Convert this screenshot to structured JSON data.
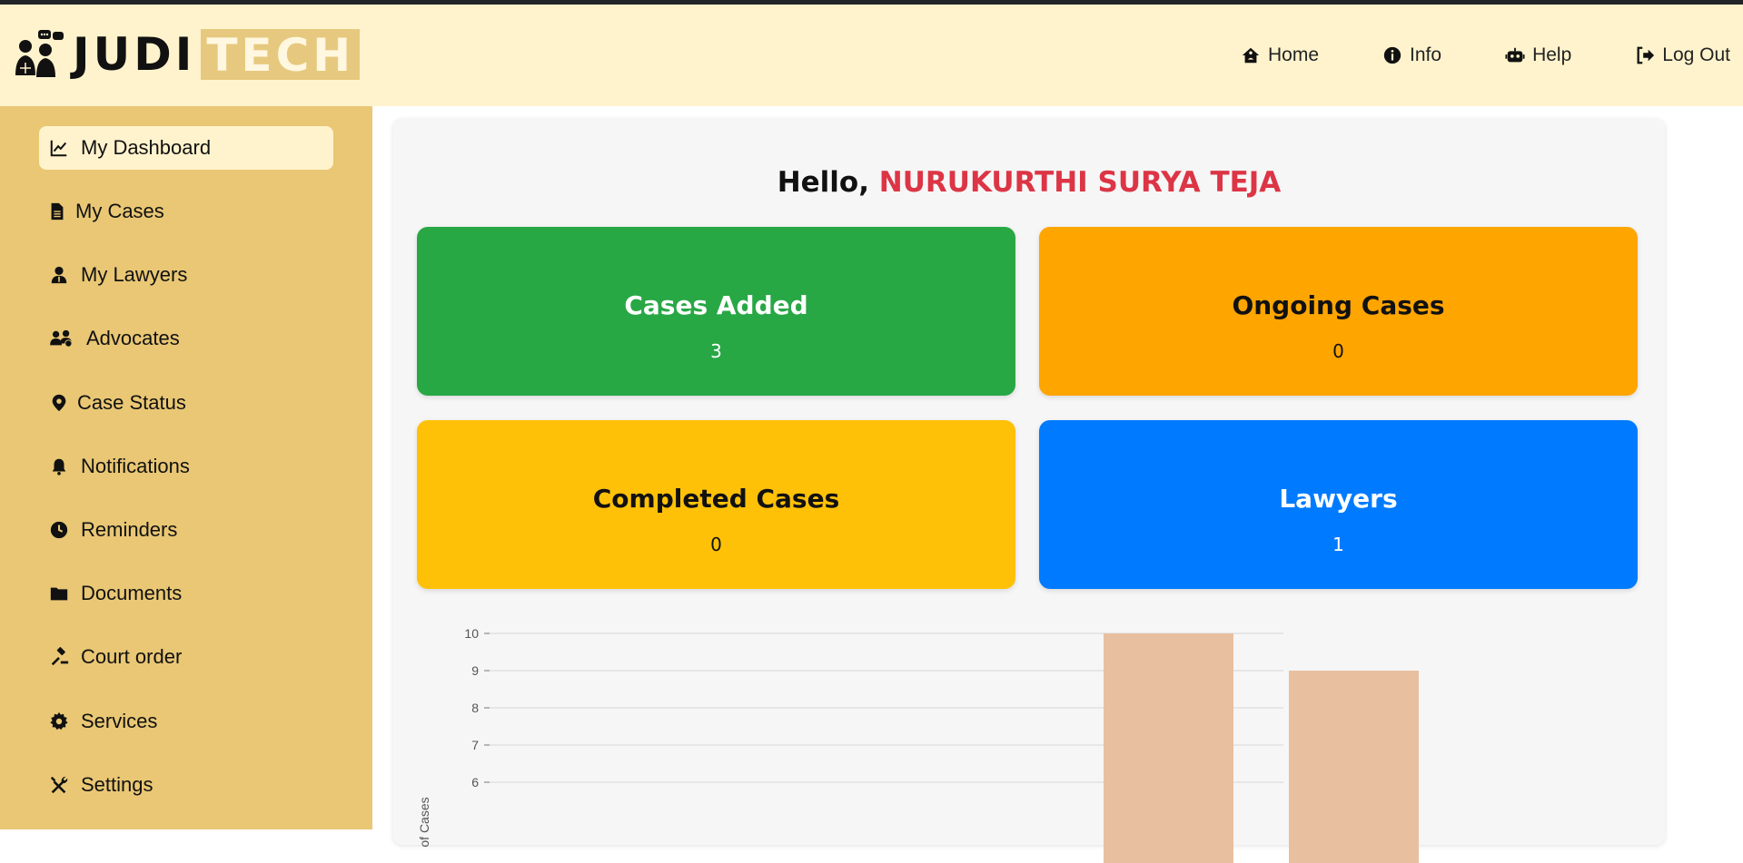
{
  "header": {
    "logo_part1": "JUDI",
    "logo_part2": "TECH",
    "nav": [
      {
        "label": "Home",
        "icon": "home-icon"
      },
      {
        "label": "Info",
        "icon": "info-icon"
      },
      {
        "label": "Help",
        "icon": "robot-icon"
      },
      {
        "label": "Log Out",
        "icon": "logout-icon"
      }
    ]
  },
  "sidebar": {
    "items": [
      {
        "label": "My Dashboard",
        "icon": "chart-line-icon",
        "active": true
      },
      {
        "label": "My Cases",
        "icon": "file-icon"
      },
      {
        "label": "My Lawyers",
        "icon": "user-tie-icon"
      },
      {
        "label": "Advocates",
        "icon": "users-icon"
      },
      {
        "label": "Case Status",
        "icon": "map-pin-icon"
      },
      {
        "label": "Notifications",
        "icon": "bell-icon"
      },
      {
        "label": "Reminders",
        "icon": "clock-icon"
      },
      {
        "label": "Documents",
        "icon": "folder-icon"
      },
      {
        "label": "Court order",
        "icon": "gavel-icon"
      },
      {
        "label": "Services",
        "icon": "gear-icon"
      },
      {
        "label": "Settings",
        "icon": "tools-icon"
      }
    ]
  },
  "main": {
    "greeting_prefix": "Hello,",
    "user_name": "NURUKURTHI SURYA TEJA",
    "stats": [
      {
        "title": "Cases Added",
        "value": "3",
        "color": "#28a745"
      },
      {
        "title": "Ongoing Cases",
        "value": "0",
        "color": "#ffa500"
      },
      {
        "title": "Completed Cases",
        "value": "0",
        "color": "#ffc107"
      },
      {
        "title": "Lawyers",
        "value": "1",
        "color": "#007bff"
      }
    ]
  },
  "chart_data": {
    "type": "bar",
    "ylabel": "of Cases",
    "yticks": [
      6,
      7,
      8,
      9,
      10
    ],
    "ylim": [
      5,
      10
    ],
    "bar_color": "#e8c0a0",
    "bars": [
      {
        "value": 10
      },
      {
        "value": 9
      }
    ]
  }
}
